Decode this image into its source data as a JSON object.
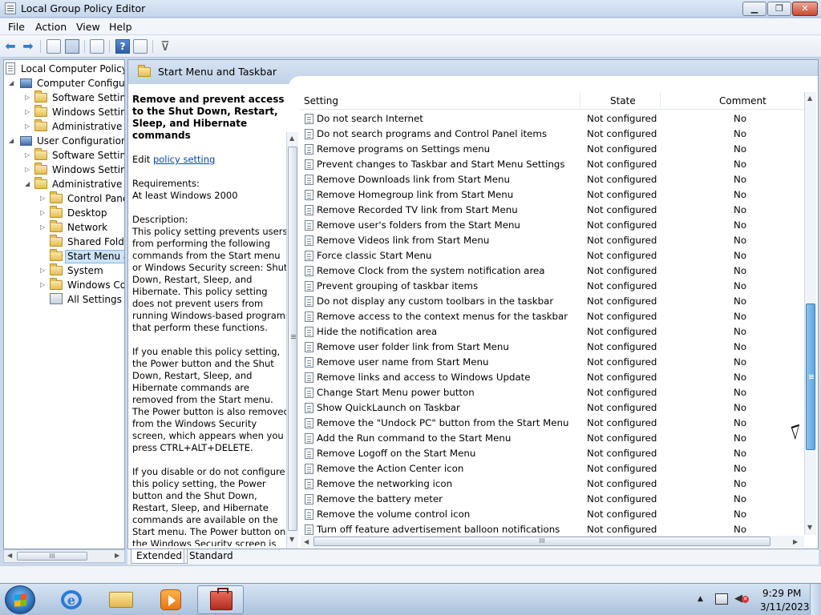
{
  "window": {
    "title": "Local Group Policy Editor",
    "min": "▁",
    "max": "❐",
    "close": "✕"
  },
  "menu": {
    "file": "File",
    "action": "Action",
    "view": "View",
    "help": "Help"
  },
  "toolbar": {
    "help_glyph": "?",
    "back_glyph": "⬅",
    "forward_glyph": "➡",
    "filter_glyph": "⊽"
  },
  "tree": {
    "items": [
      {
        "label": "Local Computer Policy"
      },
      {
        "label": "Computer Configura"
      },
      {
        "label": "Software Settings"
      },
      {
        "label": "Windows Setting"
      },
      {
        "label": "Administrative Te"
      },
      {
        "label": "User Configuration"
      },
      {
        "label": "Software Settings"
      },
      {
        "label": "Windows Setting"
      },
      {
        "label": "Administrative Te"
      },
      {
        "label": "Control Panel"
      },
      {
        "label": "Desktop"
      },
      {
        "label": "Network"
      },
      {
        "label": "Shared Folder"
      },
      {
        "label": "Start Menu ar"
      },
      {
        "label": "System"
      },
      {
        "label": "Windows Cor"
      },
      {
        "label": "All Settings"
      }
    ],
    "scroll_grip": "III"
  },
  "header": {
    "title": "Start Menu and Taskbar"
  },
  "description": {
    "title": "Remove and prevent access to the Shut Down, Restart, Sleep, and Hibernate commands",
    "edit_prefix": "Edit ",
    "edit_link": "policy setting",
    "requirements": "Requirements:\nAt least Windows 2000",
    "description": "Description:\nThis policy setting prevents users from performing the following commands from the Start menu or Windows Security screen: Shut Down, Restart, Sleep, and Hibernate. This policy setting does not prevent users from running Windows-based programs that perform these functions.",
    "enable_text": "If you enable this policy setting, the Power button and the Shut Down, Restart, Sleep, and Hibernate commands are removed from the Start menu. The Power button is also removed from the Windows Security screen, which appears when you press CTRL+ALT+DELETE.",
    "disable_text": "If you disable or do not configure this policy setting, the Power button and the Shut Down, Restart, Sleep, and Hibernate commands are available on the Start menu. The Power button on the Windows Security screen is also available."
  },
  "table": {
    "headers": {
      "setting": "Setting",
      "state": "State",
      "comment": "Comment"
    },
    "rows": [
      {
        "name": "Do not search Internet",
        "state": "Not configured",
        "comment": "No"
      },
      {
        "name": "Do not search programs and Control Panel items",
        "state": "Not configured",
        "comment": "No"
      },
      {
        "name": "Remove programs on Settings menu",
        "state": "Not configured",
        "comment": "No"
      },
      {
        "name": "Prevent changes to Taskbar and Start Menu Settings",
        "state": "Not configured",
        "comment": "No"
      },
      {
        "name": "Remove Downloads link from Start Menu",
        "state": "Not configured",
        "comment": "No"
      },
      {
        "name": "Remove Homegroup link from Start Menu",
        "state": "Not configured",
        "comment": "No"
      },
      {
        "name": "Remove Recorded TV link from Start Menu",
        "state": "Not configured",
        "comment": "No"
      },
      {
        "name": "Remove user's folders from the Start Menu",
        "state": "Not configured",
        "comment": "No"
      },
      {
        "name": "Remove Videos link from Start Menu",
        "state": "Not configured",
        "comment": "No"
      },
      {
        "name": "Force classic Start Menu",
        "state": "Not configured",
        "comment": "No"
      },
      {
        "name": "Remove Clock from the system notification area",
        "state": "Not configured",
        "comment": "No"
      },
      {
        "name": "Prevent grouping of taskbar items",
        "state": "Not configured",
        "comment": "No"
      },
      {
        "name": "Do not display any custom toolbars in the taskbar",
        "state": "Not configured",
        "comment": "No"
      },
      {
        "name": "Remove access to the context menus for the taskbar",
        "state": "Not configured",
        "comment": "No"
      },
      {
        "name": "Hide the notification area",
        "state": "Not configured",
        "comment": "No"
      },
      {
        "name": "Remove user folder link from Start Menu",
        "state": "Not configured",
        "comment": "No"
      },
      {
        "name": "Remove user name from Start Menu",
        "state": "Not configured",
        "comment": "No"
      },
      {
        "name": "Remove links and access to Windows Update",
        "state": "Not configured",
        "comment": "No"
      },
      {
        "name": "Change Start Menu power button",
        "state": "Not configured",
        "comment": "No"
      },
      {
        "name": "Show QuickLaunch on Taskbar",
        "state": "Not configured",
        "comment": "No"
      },
      {
        "name": "Remove the \"Undock PC\" button from the Start Menu",
        "state": "Not configured",
        "comment": "No"
      },
      {
        "name": "Add the Run command to the Start Menu",
        "state": "Not configured",
        "comment": "No"
      },
      {
        "name": "Remove Logoff on the Start Menu",
        "state": "Not configured",
        "comment": "No"
      },
      {
        "name": "Remove the Action Center icon",
        "state": "Not configured",
        "comment": "No"
      },
      {
        "name": "Remove the networking icon",
        "state": "Not configured",
        "comment": "No"
      },
      {
        "name": "Remove the battery meter",
        "state": "Not configured",
        "comment": "No"
      },
      {
        "name": "Remove the volume control icon",
        "state": "Not configured",
        "comment": "No"
      },
      {
        "name": "Turn off feature advertisement balloon notifications",
        "state": "Not configured",
        "comment": "No"
      }
    ],
    "scroll_grip": "III"
  },
  "tabs": {
    "extended": "Extended",
    "standard": "Standard"
  },
  "taskbar": {
    "ie_glyph": "e"
  },
  "clock": {
    "time": "9:29 PM",
    "date": "3/11/2023"
  }
}
